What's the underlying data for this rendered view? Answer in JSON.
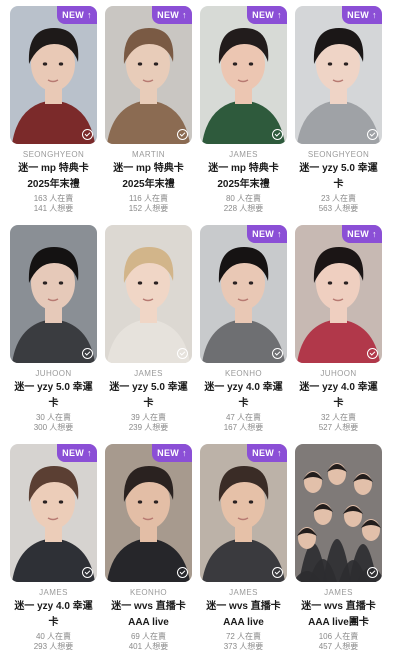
{
  "badge": {
    "label": "NEW",
    "arrow": "↑"
  },
  "cards": [
    {
      "member": "SEONGHYEON",
      "title_line1": "迷一 mp 特典卡",
      "title_line2": "2025年末禮",
      "owned": "163 人在賣",
      "wanted": "141 人想要",
      "is_new": true,
      "bg": "#b9c1cb",
      "hair": "#1e1a19",
      "skin": "#e9c9b6",
      "cloth": "#7b2a2a"
    },
    {
      "member": "MARTIN",
      "title_line1": "迷一 mp 特典卡",
      "title_line2": "2025年末禮",
      "owned": "116 人在賣",
      "wanted": "152 人想要",
      "is_new": true,
      "bg": "#c9c6c2",
      "hair": "#7a5a44",
      "skin": "#e8ccb9",
      "cloth": "#8b6b52"
    },
    {
      "member": "JAMES",
      "title_line1": "迷一 mp 特典卡",
      "title_line2": "2025年末禮",
      "owned": "80 人在賣",
      "wanted": "228 人想要",
      "is_new": true,
      "bg": "#d7dad6",
      "hair": "#221c1c",
      "skin": "#ecc6b2",
      "cloth": "#2e5a3c"
    },
    {
      "member": "SEONGHYEON",
      "title_line1": "迷一 yzy 5.0 幸運",
      "title_line2": "卡",
      "owned": "23 人在賣",
      "wanted": "563 人想要",
      "is_new": true,
      "bg": "#d4d6d8",
      "hair": "#1b1717",
      "skin": "#efd4c6",
      "cloth": "#9fa2a6"
    },
    {
      "member": "JUHOON",
      "title_line1": "迷一 yzy 5.0 幸運",
      "title_line2": "卡",
      "owned": "30 人在賣",
      "wanted": "300 人想要",
      "is_new": false,
      "bg": "#8a8f95",
      "hair": "#141212",
      "skin": "#e6c9b9",
      "cloth": "#3a3c40"
    },
    {
      "member": "JAMES",
      "title_line1": "迷一 yzy 5.0 幸運",
      "title_line2": "卡",
      "owned": "39 人在賣",
      "wanted": "239 人想要",
      "is_new": false,
      "bg": "#dcd8d2",
      "hair": "#d2b58a",
      "skin": "#f0d6c6",
      "cloth": "#e6e2dc"
    },
    {
      "member": "KEONHO",
      "title_line1": "迷一 yzy 4.0 幸運",
      "title_line2": "卡",
      "owned": "47 人在賣",
      "wanted": "167 人想要",
      "is_new": true,
      "bg": "#c8cacc",
      "hair": "#161313",
      "skin": "#e9c8b5",
      "cloth": "#6e6f72"
    },
    {
      "member": "JUHOON",
      "title_line1": "迷一 yzy 4.0 幸運",
      "title_line2": "卡",
      "owned": "32 人在賣",
      "wanted": "527 人想要",
      "is_new": true,
      "bg": "#c7b9b3",
      "hair": "#1b1515",
      "skin": "#efcfc0",
      "cloth": "#b1384a"
    },
    {
      "member": "JAMES",
      "title_line1": "迷一 yzy 4.0 幸運",
      "title_line2": "卡",
      "owned": "40 人在賣",
      "wanted": "293 人想要",
      "is_new": true,
      "bg": "#d6d3d0",
      "hair": "#5b3f33",
      "skin": "#eccdb9",
      "cloth": "#2e3036"
    },
    {
      "member": "KEONHO",
      "title_line1": "迷一 wvs 直播卡",
      "title_line2": "AAA live",
      "owned": "69 人在賣",
      "wanted": "401 人想要",
      "is_new": true,
      "bg": "#a79a8e",
      "hair": "#2a2220",
      "skin": "#e3bea6",
      "cloth": "#26262a"
    },
    {
      "member": "JAMES",
      "title_line1": "迷一 wvs 直播卡",
      "title_line2": "AAA live",
      "owned": "72 人在賣",
      "wanted": "373 人想要",
      "is_new": true,
      "bg": "#bcb2a8",
      "hair": "#3a2c26",
      "skin": "#e6c1a8",
      "cloth": "#3a3a3e"
    },
    {
      "member": "JAMES",
      "title_line1": "迷一 wvs 直播卡",
      "title_line2": "AAA live團卡",
      "owned": "106 人在賣",
      "wanted": "457 人想要",
      "is_new": false,
      "bg": "#7f7a78",
      "hair": "#221d1c",
      "skin": "#e2c0aa",
      "cloth": "#2c2c30",
      "group": true
    }
  ]
}
